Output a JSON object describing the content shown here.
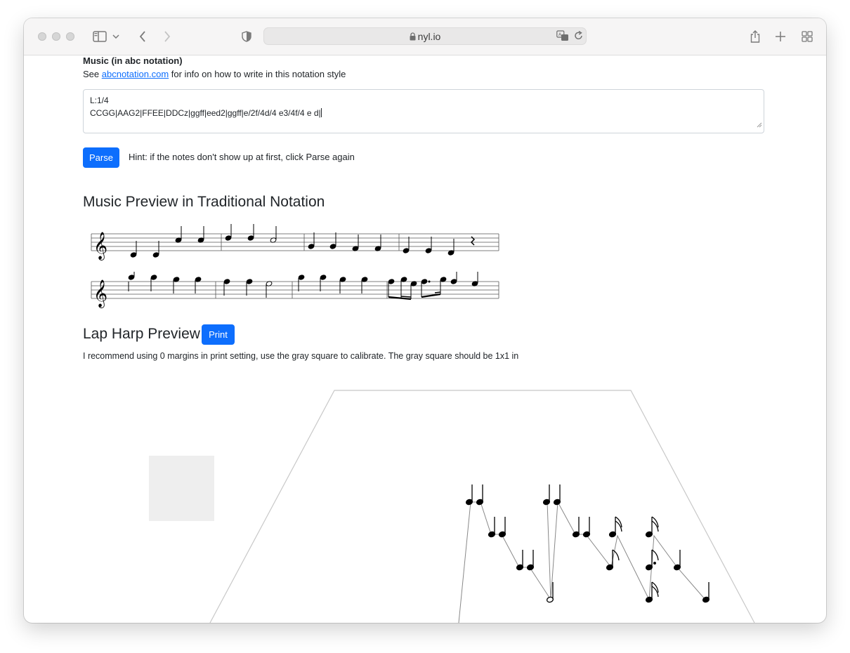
{
  "browser": {
    "url": "nyl.io",
    "icons": [
      "sidebar-icon",
      "chevron-down-icon",
      "back-icon",
      "forward-icon",
      "shield-icon",
      "lock-icon",
      "translate-icon",
      "reload-icon",
      "share-icon",
      "new-tab-icon",
      "tab-overview-icon"
    ]
  },
  "form": {
    "music_label": "Music (in abc notation)",
    "see_prefix": "See ",
    "see_link": "abcnotation.com",
    "see_suffix": " for info on how to write in this notation style",
    "abc_line1": "L:1/4",
    "abc_line2": "CCGG|AAG2|FFEE|DDCz|ggff|eed2|ggff|e/2f/4d/4 e3/4f/4 e d|",
    "parse_label": "Parse",
    "hint": "Hint: if the notes don't show up at first, click Parse again"
  },
  "preview": {
    "title": "Music Preview in Traditional Notation"
  },
  "harp": {
    "title": "Lap Harp Preview",
    "print_label": "Print",
    "instructions": "I recommend using 0 margins in print setting, use the gray square to calibrate. The gray square should be 1x1 in"
  },
  "colors": {
    "primary": "#0d6efd",
    "calibration_square": "#eeeeee"
  }
}
